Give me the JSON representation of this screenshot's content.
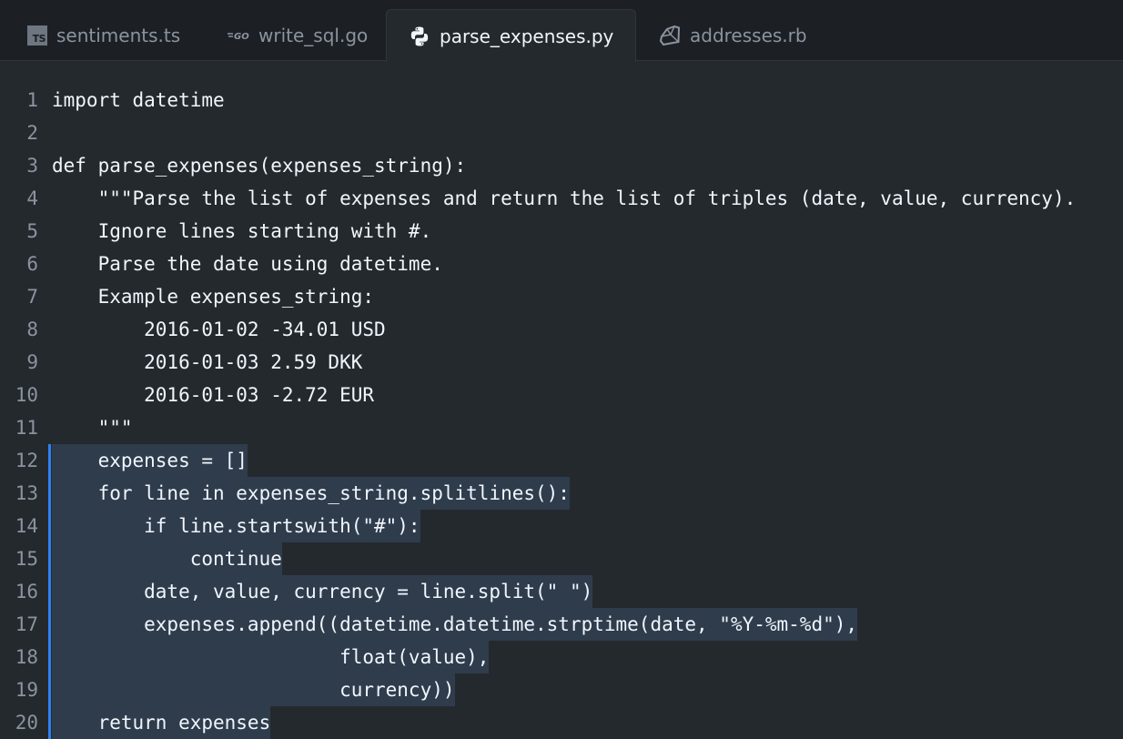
{
  "tabs": [
    {
      "label": "sentiments.ts",
      "icon": "typescript-icon",
      "active": false
    },
    {
      "label": "write_sql.go",
      "icon": "go-icon",
      "active": false
    },
    {
      "label": "parse_expenses.py",
      "icon": "python-icon",
      "active": true
    },
    {
      "label": "addresses.rb",
      "icon": "ruby-icon",
      "active": false
    }
  ],
  "ts_icon_text": "TS",
  "editor": {
    "lines": [
      {
        "n": "1",
        "code": "import datetime"
      },
      {
        "n": "2",
        "code": ""
      },
      {
        "n": "3",
        "code": "def parse_expenses(expenses_string):"
      },
      {
        "n": "4",
        "code": "    \"\"\"Parse the list of expenses and return the list of triples (date, value, currency)."
      },
      {
        "n": "5",
        "code": "    Ignore lines starting with #."
      },
      {
        "n": "6",
        "code": "    Parse the date using datetime."
      },
      {
        "n": "7",
        "code": "    Example expenses_string:"
      },
      {
        "n": "8",
        "code": "        2016-01-02 -34.01 USD"
      },
      {
        "n": "9",
        "code": "        2016-01-03 2.59 DKK"
      },
      {
        "n": "10",
        "code": "        2016-01-03 -2.72 EUR"
      },
      {
        "n": "11",
        "code": "    \"\"\""
      },
      {
        "n": "12",
        "code": "    expenses = []"
      },
      {
        "n": "13",
        "code": "    for line in expenses_string.splitlines():"
      },
      {
        "n": "14",
        "code": "        if line.startswith(\"#\"):"
      },
      {
        "n": "15",
        "code": "            continue"
      },
      {
        "n": "16",
        "code": "        date, value, currency = line.split(\" \")"
      },
      {
        "n": "17",
        "code": "        expenses.append((datetime.datetime.strptime(date, \"%Y-%m-%d\"),"
      },
      {
        "n": "18",
        "code": "                         float(value),"
      },
      {
        "n": "19",
        "code": "                         currency))"
      },
      {
        "n": "20",
        "code": "    return expenses"
      }
    ]
  },
  "colors": {
    "background": "#24292e",
    "tabbar": "#1c2025",
    "selection": "#2f3c4c",
    "selection_bar": "#2f81f7"
  }
}
